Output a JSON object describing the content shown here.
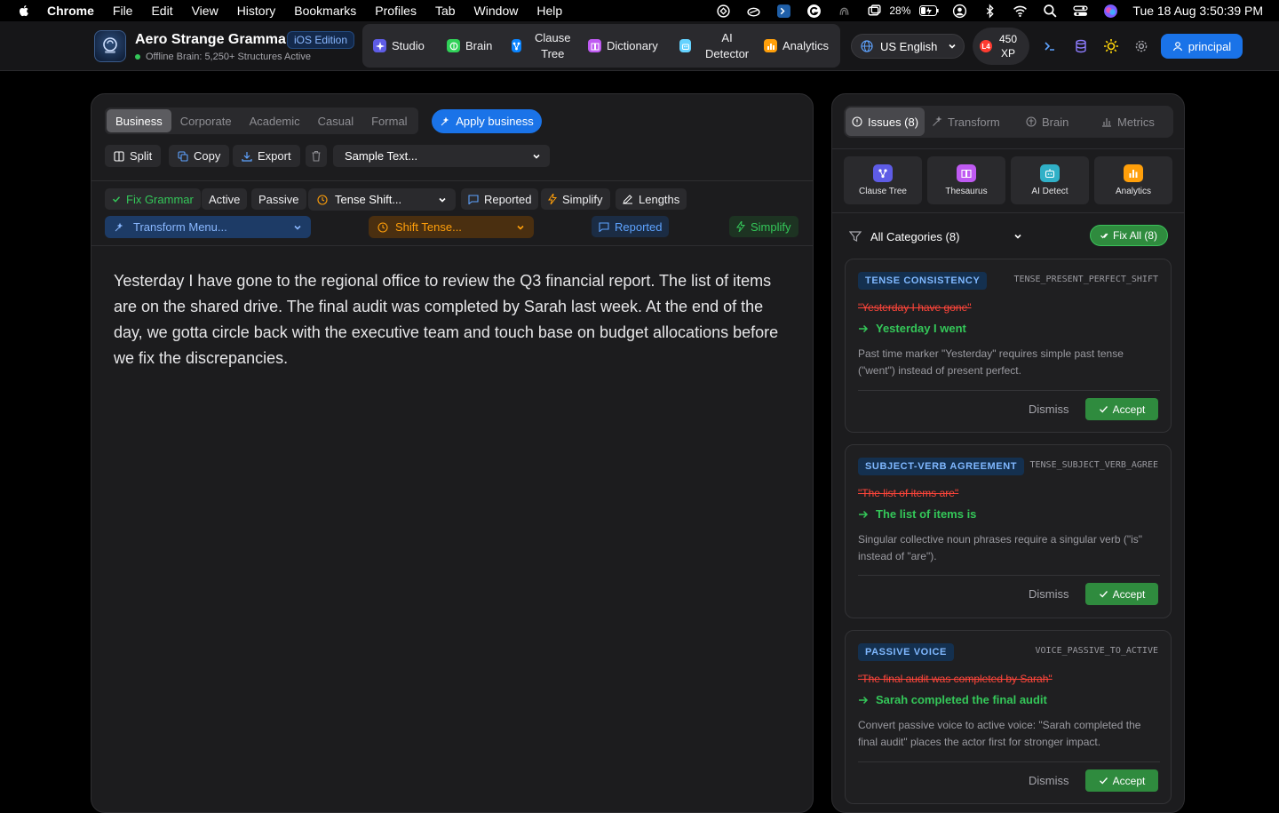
{
  "menubar": {
    "app": "Chrome",
    "items": [
      "File",
      "Edit",
      "View",
      "History",
      "Bookmarks",
      "Profiles",
      "Tab",
      "Window",
      "Help"
    ],
    "battery": "28%",
    "clock": "Tue 18 Aug  3:50:39 PM"
  },
  "header": {
    "title": "Aero Strange Grammar",
    "edition": "iOS Edition",
    "status": "Offline Brain: 5,250+ Structures Active",
    "nav": [
      {
        "label": "Studio",
        "icon": "sparkle-icon",
        "color": "#5e5ce6"
      },
      {
        "label": "Brain",
        "icon": "brain-icon",
        "color": "#30d158"
      },
      {
        "label": "Clause\nTree",
        "icon": "tree-icon",
        "color": "#0a84ff"
      },
      {
        "label": "Dictionary",
        "icon": "book-icon",
        "color": "#bf5af2"
      },
      {
        "label": "AI\nDetector",
        "icon": "robot-icon",
        "color": "#64d2ff"
      },
      {
        "label": "Analytics",
        "icon": "bar-chart-icon",
        "color": "#ff9f0a"
      }
    ],
    "language": "US English",
    "level": "L4",
    "xp": "450\nXP",
    "user": "principal"
  },
  "editor": {
    "tones": [
      "Business",
      "Corporate",
      "Academic",
      "Casual",
      "Formal"
    ],
    "active_tone": "Business",
    "apply_label": "Apply business",
    "toolbar": {
      "split": "Split",
      "copy": "Copy",
      "export": "Export",
      "sample": "Sample Text..."
    },
    "row1": {
      "fix": "Fix Grammar",
      "active": "Active",
      "passive": "Passive",
      "tense": "Tense Shift...",
      "reported": "Reported",
      "simplify": "Simplify",
      "lengths": "Lengths"
    },
    "row2": {
      "transform": "Transform Menu...",
      "shift": "Shift Tense...",
      "reported": "Reported",
      "simplify": "Simplify"
    },
    "text": "Yesterday I have gone to the regional office to review the Q3 financial report. The list of items are on the shared drive. The final audit was completed by Sarah last week. At the end of the day, we gotta circle back with the executive team and touch base on budget allocations before we fix the discrepancies."
  },
  "side": {
    "tabs": [
      "Issues (8)",
      "Transform",
      "Brain",
      "Metrics"
    ],
    "tools": [
      {
        "label": "Clause Tree",
        "color": "#5e5ce6"
      },
      {
        "label": "Thesaurus",
        "color": "#bf5af2"
      },
      {
        "label": "AI Detect",
        "color": "#30b0c7"
      },
      {
        "label": "Analytics",
        "color": "#ff9f0a"
      }
    ],
    "filter": "All Categories (8)",
    "fix_all": "Fix All (8)",
    "issues": [
      {
        "category": "TENSE CONSISTENCY",
        "code": "TENSE_PRESENT_PERFECT_SHIFT",
        "original": "\"Yesterday I have gone\"",
        "fix": "Yesterday I went",
        "explanation": "Past time marker \"Yesterday\" requires simple past tense (\"went\") instead of present perfect.",
        "dismiss": "Dismiss",
        "accept": "Accept"
      },
      {
        "category": "SUBJECT-VERB AGREEMENT",
        "code": "TENSE_SUBJECT_VERB_AGREE",
        "original": "\"The list of items are\"",
        "fix": "The list of items is",
        "explanation": "Singular collective noun phrases require a singular verb (\"is\" instead of \"are\").",
        "dismiss": "Dismiss",
        "accept": "Accept"
      },
      {
        "category": "PASSIVE VOICE",
        "code": "VOICE_PASSIVE_TO_ACTIVE",
        "original": "\"The final audit was completed by Sarah\"",
        "fix": "Sarah completed the final audit",
        "explanation": "Convert passive voice to active voice: \"Sarah completed the final audit\" places the actor first for stronger impact.",
        "dismiss": "Dismiss",
        "accept": "Accept"
      }
    ]
  }
}
